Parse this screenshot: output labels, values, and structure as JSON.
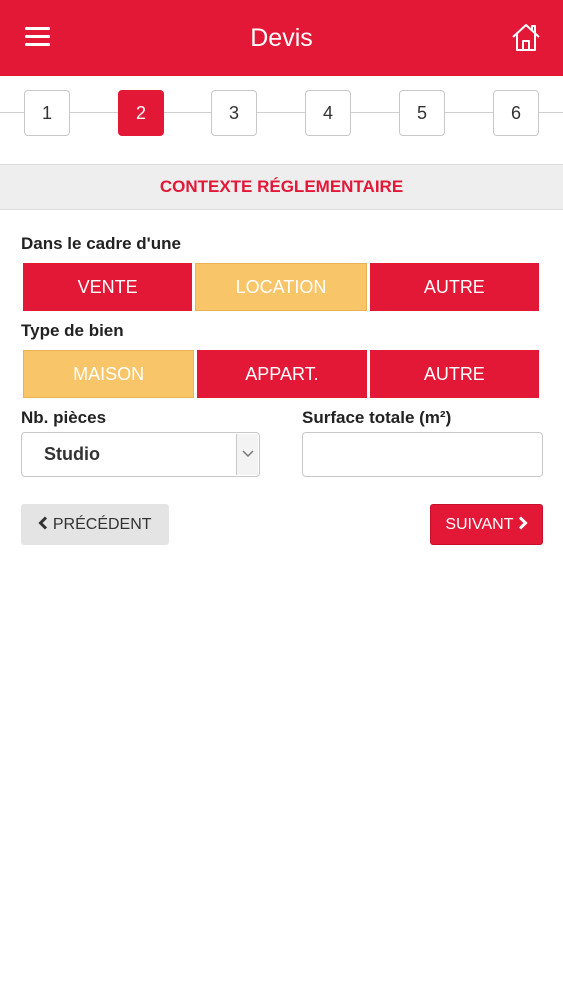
{
  "header": {
    "title": "Devis",
    "menu_icon": "hamburger-menu-icon",
    "home_icon": "home-icon",
    "color": "#e31837"
  },
  "stepper": {
    "steps": [
      "1",
      "2",
      "3",
      "4",
      "5",
      "6"
    ],
    "active_step": "2"
  },
  "section": {
    "title": "CONTEXTE RÉGLEMENTAIRE"
  },
  "cadre": {
    "label": "Dans le cadre d'une",
    "options": [
      "VENTE",
      "LOCATION",
      "AUTRE"
    ],
    "selected": "LOCATION"
  },
  "type_bien": {
    "label": "Type de bien",
    "options": [
      "MAISON",
      "APPART.",
      "AUTRE"
    ],
    "selected": "MAISON"
  },
  "pieces": {
    "label": "Nb. pièces",
    "value": "Studio"
  },
  "surface": {
    "label": "Surface totale (m²)",
    "value": "",
    "placeholder": ""
  },
  "nav": {
    "prev_label": "PRÉCÉDENT",
    "next_label": "SUIVANT"
  },
  "colors": {
    "accent": "#e31837",
    "selected": "#f9c569",
    "section_bg": "#eeeeee"
  }
}
